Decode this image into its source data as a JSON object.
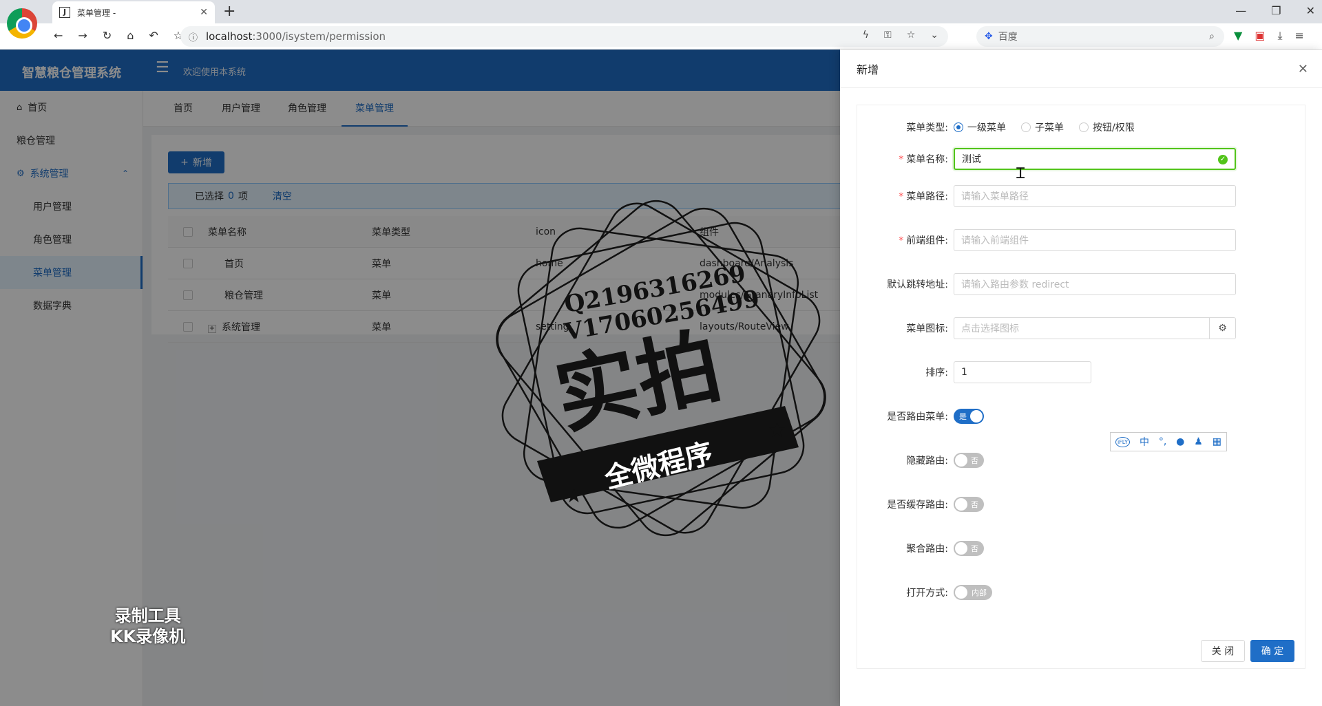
{
  "browser": {
    "tab_title": "菜单管理 -",
    "tab_favicon": "J",
    "url_host": "localhost",
    "url_path": ":3000/isystem/permission",
    "search_placeholder": "百度"
  },
  "app": {
    "logo": "智慧粮仓管理系统",
    "welcome": "欢迎使用本系统"
  },
  "sidebar": {
    "items": [
      {
        "label": "首页",
        "icon": "home-icon"
      },
      {
        "label": "粮仓管理"
      },
      {
        "label": "系统管理",
        "icon": "gear-icon"
      },
      {
        "label": "用户管理"
      },
      {
        "label": "角色管理"
      },
      {
        "label": "菜单管理"
      },
      {
        "label": "数据字典"
      }
    ]
  },
  "page_tabs": [
    "首页",
    "用户管理",
    "角色管理",
    "菜单管理"
  ],
  "toolbar": {
    "add_label": "新增"
  },
  "selection": {
    "prefix": "已选择",
    "count": "0",
    "suffix": "项",
    "clear": "清空"
  },
  "table": {
    "headers": [
      "菜单名称",
      "菜单类型",
      "icon",
      "组件"
    ],
    "rows": [
      {
        "name": "首页",
        "type": "菜单",
        "icon": "home",
        "component": "dashboard/Analysis"
      },
      {
        "name": "粮仓管理",
        "type": "菜单",
        "icon": "",
        "component": "modules/GranaryInfoList"
      },
      {
        "name": "系统管理",
        "type": "菜单",
        "icon": "setting",
        "component": "layouts/RouteView"
      }
    ]
  },
  "drawer": {
    "title": "新增",
    "menu_type_label": "菜单类型:",
    "menu_type_options": [
      "一级菜单",
      "子菜单",
      "按钮/权限"
    ],
    "name_label": "菜单名称:",
    "name_value": "测试",
    "path_label": "菜单路径:",
    "path_placeholder": "请输入菜单路径",
    "component_label": "前端组件:",
    "component_placeholder": "请输入前端组件",
    "redirect_label": "默认跳转地址:",
    "redirect_placeholder": "请输入路由参数 redirect",
    "icon_label": "菜单图标:",
    "icon_placeholder": "点击选择图标",
    "sort_label": "排序:",
    "sort_value": "1",
    "route_label": "是否路由菜单:",
    "route_switch": "是",
    "hidden_label": "隐藏路由:",
    "hidden_switch": "否",
    "cache_label": "是否缓存路由:",
    "cache_switch": "否",
    "agg_label": "聚合路由:",
    "agg_switch": "否",
    "open_label": "打开方式:",
    "open_switch": "内部",
    "close_btn": "关 闭",
    "ok_btn": "确 定"
  },
  "watermark": {
    "qq": "Q2196316269",
    "v": "V17060256499",
    "big": "实拍",
    "banner": "全微程序",
    "kk1": "录制工具",
    "kk2": "KK录像机"
  },
  "ime_icons": [
    "iFLY",
    "中",
    "°,",
    "mic",
    "user",
    "grid"
  ],
  "colors": {
    "primary": "#1f6ec7",
    "success": "#52c41a",
    "required": "#ff4d4f"
  }
}
